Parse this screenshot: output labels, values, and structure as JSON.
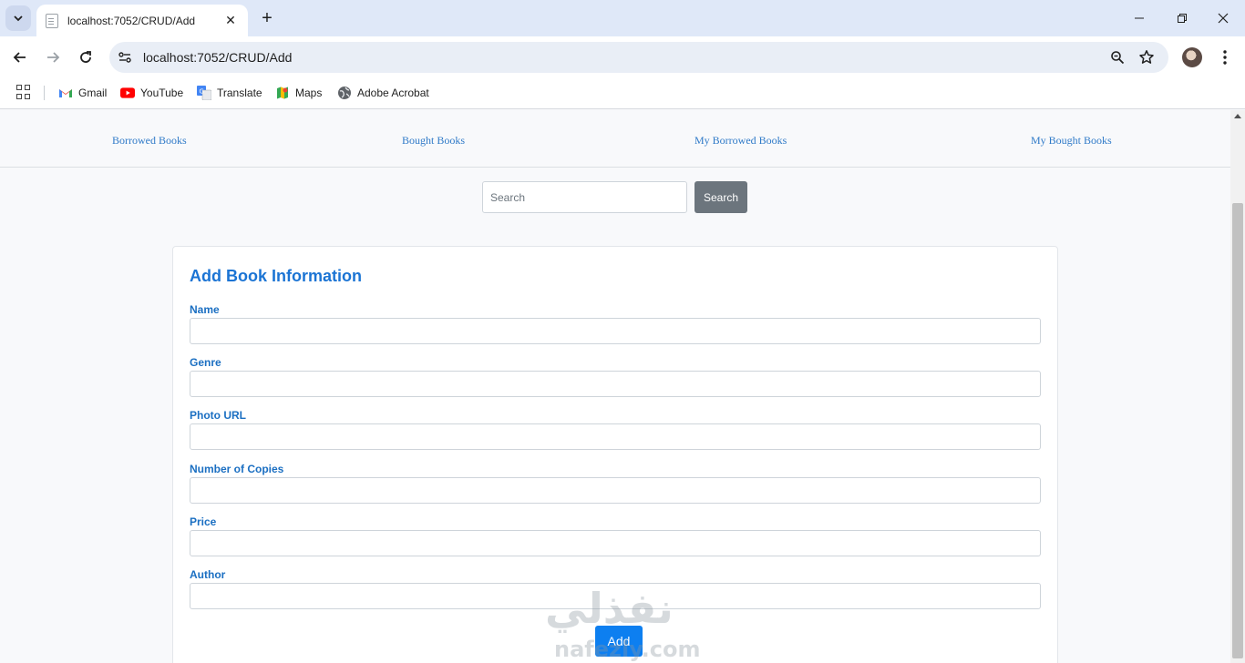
{
  "browser": {
    "tab_title": "localhost:7052/CRUD/Add",
    "url": "localhost:7052/CRUD/Add",
    "bookmarks": [
      {
        "label": "Gmail",
        "icon": "gmail-icon"
      },
      {
        "label": "YouTube",
        "icon": "youtube-icon"
      },
      {
        "label": "Translate",
        "icon": "translate-icon"
      },
      {
        "label": "Maps",
        "icon": "maps-icon"
      },
      {
        "label": "Adobe Acrobat",
        "icon": "globe-icon"
      }
    ]
  },
  "nav": {
    "links": [
      "Borrowed Books",
      "Bought Books",
      "My Borrowed Books",
      "My Bought Books"
    ]
  },
  "search": {
    "placeholder": "Search",
    "button": "Search"
  },
  "form": {
    "title": "Add Book Information",
    "fields": [
      {
        "label": "Name",
        "value": ""
      },
      {
        "label": "Genre",
        "value": ""
      },
      {
        "label": "Photo URL",
        "value": ""
      },
      {
        "label": "Number of Copies",
        "value": ""
      },
      {
        "label": "Price",
        "value": ""
      },
      {
        "label": "Author",
        "value": ""
      }
    ],
    "submit": "Add"
  },
  "watermark": {
    "arabic": "نفذلي",
    "latin": "nafezly.com"
  },
  "colors": {
    "link": "#2f7ac8",
    "title": "#1b74d4",
    "primary": "#0d7ff0",
    "secondary": "#6c757d"
  }
}
